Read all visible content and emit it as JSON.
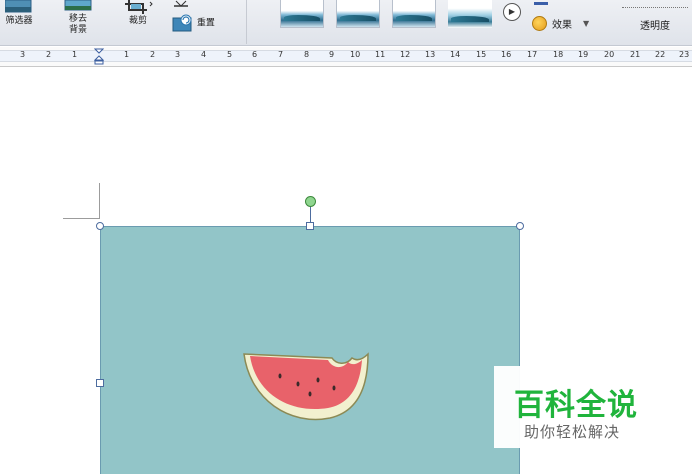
{
  "ribbon": {
    "filter_label": "筛选器",
    "move_bg_label_line1": "移去",
    "move_bg_label_line2": "背景",
    "crop_label": "裁剪",
    "reset_label": "重置",
    "effects_label": "效果",
    "opacity_label": "透明度"
  },
  "ruler": {
    "numbers": [
      "3",
      "2",
      "1",
      "1",
      "2",
      "3",
      "4",
      "5",
      "6",
      "7",
      "8",
      "9",
      "10",
      "11",
      "12",
      "13",
      "14",
      "15",
      "16",
      "17",
      "18",
      "19",
      "20",
      "21",
      "22",
      "23"
    ]
  },
  "watermark": {
    "title": "百科全说",
    "subtitle": "助你轻松解决"
  },
  "colors": {
    "picture_background": "#92c5c8",
    "watermelon_flesh": "#e8626a",
    "watermelon_rind": "#f2f0cf",
    "watermark_green": "#20b43c"
  }
}
